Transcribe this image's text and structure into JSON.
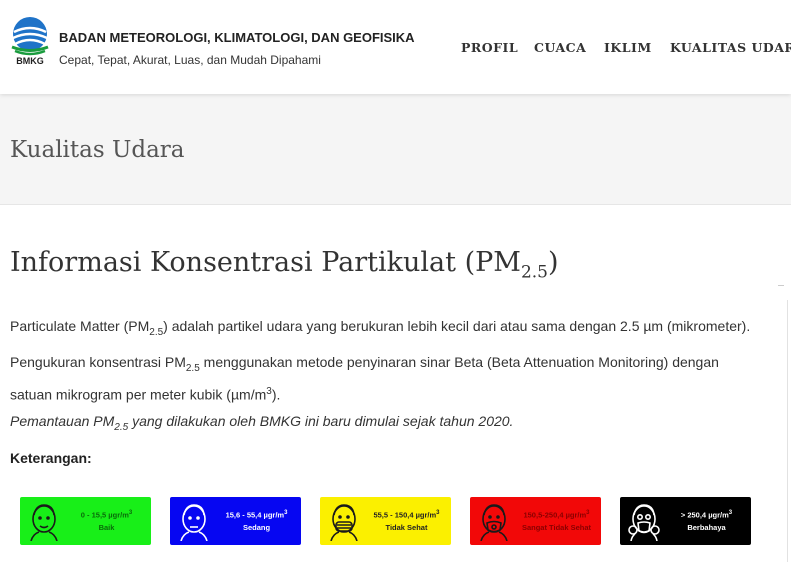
{
  "header": {
    "logo_text": "BMKG",
    "org_name": "BADAN METEOROLOGI, KLIMATOLOGI, DAN GEOFISIKA",
    "tagline": "Cepat, Tepat, Akurat, Luas, dan Mudah Dipahami",
    "nav": [
      {
        "label": "PROFIL"
      },
      {
        "label": "CUACA"
      },
      {
        "label": "IKLIM"
      },
      {
        "label": "KUALITAS UDARA"
      }
    ]
  },
  "banner": {
    "title": "Kualitas Udara"
  },
  "main": {
    "heading": "Informasi Konsentrasi Partikulat (PM",
    "heading_sub": "2.5",
    "heading_end": ")",
    "p1": {
      "a": "Particulate Matter (PM",
      "sub": "2.5",
      "b": ") adalah partikel udara yang berukuran lebih kecil dari atau sama dengan 2.5 µm (mikrometer)."
    },
    "p2": {
      "a": "Pengukuran konsentrasi PM",
      "sub": "2.5",
      "b": " menggunakan metode penyinaran sinar Beta (Beta Attenuation Monitoring) dengan satuan mikrogram per meter kubik (µm/m",
      "sup": "3",
      "c": ")."
    },
    "p3": {
      "a": "Pemantauan PM",
      "sub": "2.5",
      "b": " yang dilakukan oleh BMKG ini baru dimulai sejak tahun 2020."
    },
    "legend_title": "Keterangan:"
  },
  "legend": [
    {
      "range": "0 - 15,5 µgr/m",
      "sup": "3",
      "category": "Baik",
      "bg": "#18ef18",
      "fg": "#0a6b0a"
    },
    {
      "range": "15,6 - 55,4 µgr/m",
      "sup": "3",
      "category": "Sedang",
      "bg": "#0606f2",
      "fg": "#ffffff"
    },
    {
      "range": "55,5 - 150,4 µgr/m",
      "sup": "3",
      "category": "Tidak Sehat",
      "bg": "#fbf000",
      "fg": "#222222"
    },
    {
      "range": "150,5-250,4 µgr/m",
      "sup": "3",
      "category": "Sangat Tidak Sehat",
      "bg": "#f20808",
      "fg": "#8a0000"
    },
    {
      "range": "> 250,4 µgr/m",
      "sup": "3",
      "category": "Berbahaya",
      "bg": "#000000",
      "fg": "#ffffff"
    }
  ]
}
